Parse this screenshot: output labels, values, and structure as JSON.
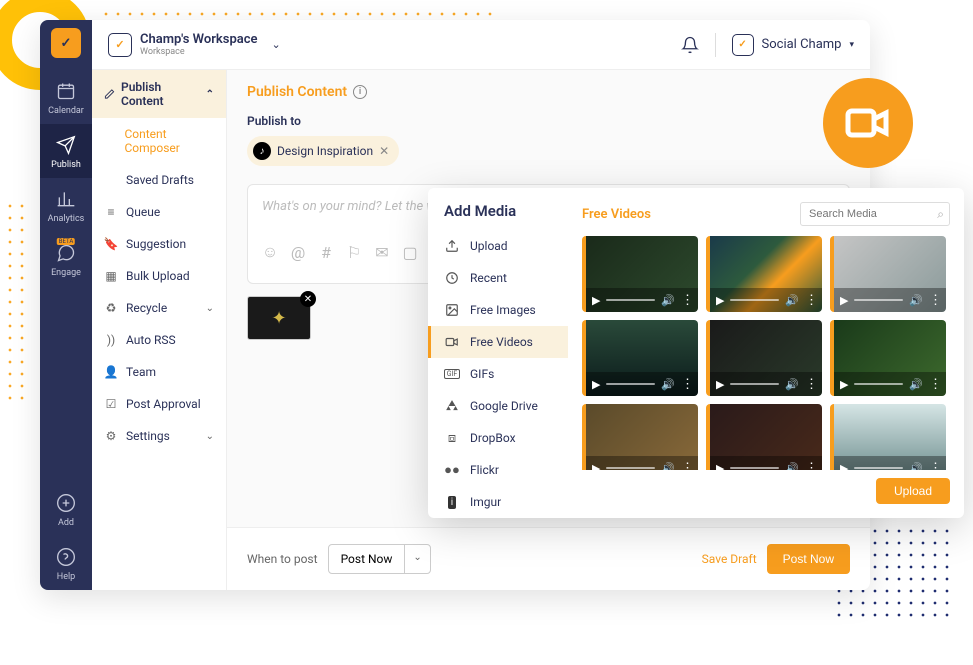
{
  "rail": {
    "items": [
      {
        "label": "Calendar",
        "icon": "calendar"
      },
      {
        "label": "Publish",
        "icon": "paper-plane",
        "active": true
      },
      {
        "label": "Analytics",
        "icon": "chart"
      },
      {
        "label": "Engage",
        "icon": "chat",
        "beta": true
      }
    ],
    "bottom": [
      {
        "label": "Add",
        "icon": "plus"
      },
      {
        "label": "Help",
        "icon": "question"
      }
    ]
  },
  "workspace": {
    "name": "Champ's Workspace",
    "subtitle": "Workspace"
  },
  "user": {
    "name": "Social Champ"
  },
  "sidebar": {
    "header": "Publish Content",
    "items": [
      {
        "label": "Content Composer",
        "icon": "",
        "active": true
      },
      {
        "label": "Saved Drafts",
        "icon": ""
      },
      {
        "label": "Queue",
        "icon": "list"
      },
      {
        "label": "Suggestion",
        "icon": "bookmark"
      },
      {
        "label": "Bulk Upload",
        "icon": "grid"
      },
      {
        "label": "Recycle",
        "icon": "recycle",
        "chevron": true
      },
      {
        "label": "Auto RSS",
        "icon": "rss"
      },
      {
        "label": "Team",
        "icon": "user"
      },
      {
        "label": "Post Approval",
        "icon": "check-square"
      },
      {
        "label": "Settings",
        "icon": "gear",
        "chevron": true
      }
    ]
  },
  "pane": {
    "title": "Publish Content",
    "publish_label": "Publish to",
    "chip": {
      "label": "Design Inspiration"
    },
    "composer_placeholder": "What's on your mind? Let the world know!",
    "when_label": "When to post",
    "when_value": "Post Now",
    "save_draft": "Save Draft",
    "post_now": "Post Now"
  },
  "media": {
    "title": "Add Media",
    "items": [
      {
        "label": "Upload",
        "icon": "upload"
      },
      {
        "label": "Recent",
        "icon": "clock"
      },
      {
        "label": "Free Images",
        "icon": "image"
      },
      {
        "label": "Free Videos",
        "icon": "video",
        "active": true
      },
      {
        "label": "GIFs",
        "icon": "gif"
      },
      {
        "label": "Google Drive",
        "icon": "gdrive"
      },
      {
        "label": "DropBox",
        "icon": "dropbox"
      },
      {
        "label": "Flickr",
        "icon": "flickr"
      },
      {
        "label": "Imgur",
        "icon": "imgur"
      }
    ],
    "right_title": "Free Videos",
    "search_placeholder": "Search Media",
    "upload_btn": "Upload",
    "videos": [
      {
        "bg": "linear-gradient(135deg,#1a2a1a,#2d4a2d)"
      },
      {
        "bg": "linear-gradient(135deg,#1a3a4a,#2d5a3d 40%,#f79d1e 60%,#2d5a3d)"
      },
      {
        "bg": "linear-gradient(135deg,#c5c5c5,#8a9a9a)"
      },
      {
        "bg": "linear-gradient(180deg,#2a4a3a,#0a1a1a)"
      },
      {
        "bg": "linear-gradient(135deg,#1a1a1a,#2a3a2a)"
      },
      {
        "bg": "linear-gradient(135deg,#1a3a1a,#3d6a2d)"
      },
      {
        "bg": "linear-gradient(135deg,#5a4a2a,#8a6a3a)"
      },
      {
        "bg": "linear-gradient(135deg,#2a1a1a,#4a2a1a)"
      },
      {
        "bg": "linear-gradient(180deg,#d5e5e5,#6a8a8a)"
      },
      {
        "bg": "linear-gradient(135deg,#1a1a2a,#3a3a4a)"
      },
      {
        "bg": "linear-gradient(180deg,#e5c5d5,#d5a5b5)"
      },
      {
        "bg": "linear-gradient(135deg,#c5b5d5,#a595c5)"
      }
    ]
  }
}
